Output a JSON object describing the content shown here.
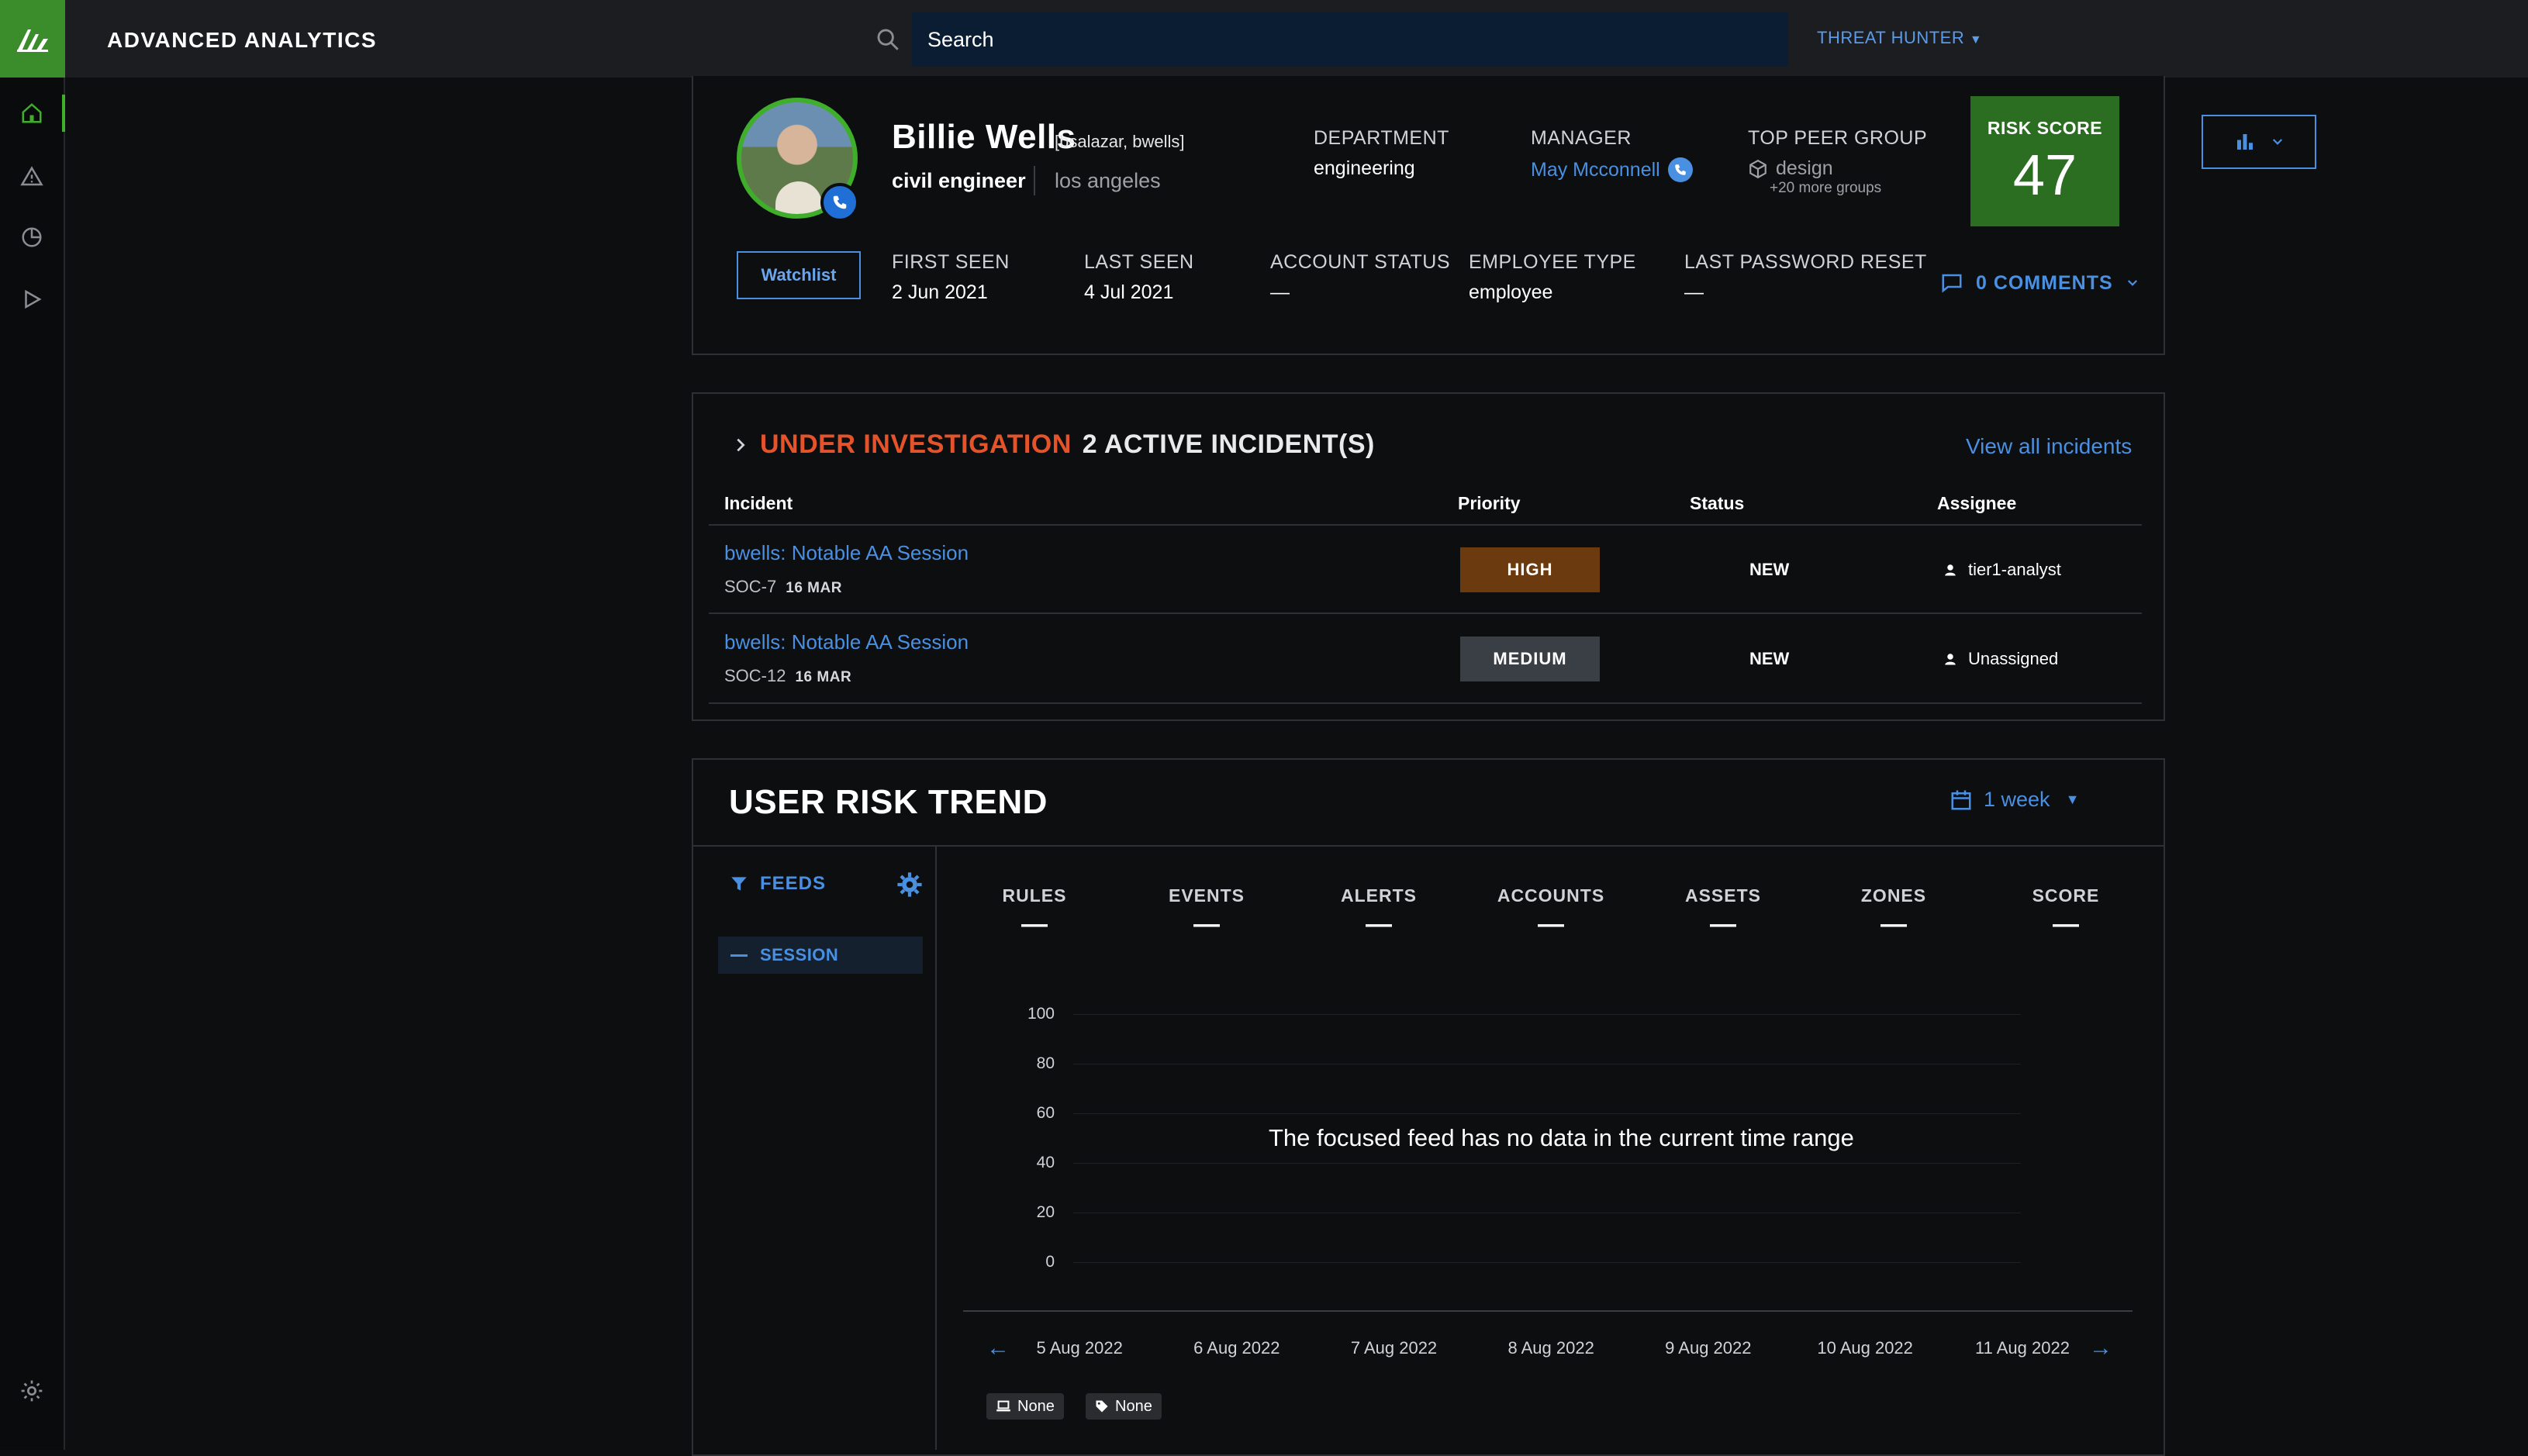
{
  "app": {
    "name": "ADVANCED ANALYTICS",
    "role": "THREAT HUNTER"
  },
  "search": {
    "placeholder": "Search"
  },
  "user": {
    "name": "Billie Wells",
    "aliases": "[bsalazar, bwells]",
    "title": "civil engineer",
    "location": "los angeles",
    "department_label": "DEPARTMENT",
    "department": "engineering",
    "manager_label": "MANAGER",
    "manager": "May Mcconnell",
    "peer_group_label": "TOP PEER GROUP",
    "peer_group": "design",
    "peer_group_more": "+20 more groups",
    "risk_label": "RISK SCORE",
    "risk_score": "47",
    "watchlist_label": "Watchlist",
    "first_seen_label": "FIRST SEEN",
    "first_seen": "2 Jun 2021",
    "last_seen_label": "LAST SEEN",
    "last_seen": "4 Jul 2021",
    "account_status_label": "ACCOUNT STATUS",
    "account_status": "—",
    "employee_type_label": "EMPLOYEE TYPE",
    "employee_type": "employee",
    "password_reset_label": "LAST PASSWORD RESET",
    "password_reset": "—",
    "comments_label": "0 COMMENTS"
  },
  "incidents": {
    "status": "UNDER INVESTIGATION",
    "count_text": "2 ACTIVE INCIDENT(S)",
    "view_all": "View all incidents",
    "columns": [
      "Incident",
      "Priority",
      "Status",
      "Assignee"
    ],
    "rows": [
      {
        "title": "bwells: Notable AA Session",
        "id": "SOC-7",
        "date": "16 MAR",
        "priority": "HIGH",
        "priority_color": "#6b3a0f",
        "status": "NEW",
        "assignee": "tier1-analyst"
      },
      {
        "title": "bwells: Notable AA Session",
        "id": "SOC-12",
        "date": "16 MAR",
        "priority": "MEDIUM",
        "priority_color": "#3a3e45",
        "status": "NEW",
        "assignee": "Unassigned"
      }
    ]
  },
  "trend": {
    "title": "USER RISK TREND",
    "range": "1 week",
    "feeds_label": "FEEDS",
    "feed_item": "SESSION",
    "metrics": [
      {
        "label": "RULES",
        "value": "—"
      },
      {
        "label": "EVENTS",
        "value": "—"
      },
      {
        "label": "ALERTS",
        "value": "—"
      },
      {
        "label": "ACCOUNTS",
        "value": "—"
      },
      {
        "label": "ASSETS",
        "value": "—"
      },
      {
        "label": "ZONES",
        "value": "—"
      },
      {
        "label": "SCORE",
        "value": "—"
      }
    ],
    "no_data_message": "The focused feed has no data in the current time range",
    "tags": [
      "None",
      "None"
    ]
  },
  "chart_data": {
    "type": "line",
    "x": [
      "5 Aug 2022",
      "6 Aug 2022",
      "7 Aug 2022",
      "8 Aug 2022",
      "9 Aug 2022",
      "10 Aug 2022",
      "11 Aug 2022"
    ],
    "series": [],
    "yticks": [
      "0",
      "20",
      "40",
      "60",
      "80",
      "100"
    ],
    "ylim": [
      0,
      100
    ],
    "grid": true
  },
  "colors": {
    "accent": "#4a90e2",
    "brand_green": "#3a8d2a",
    "risk_box": "#2b6e22",
    "under_investigation": "#e5532a"
  }
}
